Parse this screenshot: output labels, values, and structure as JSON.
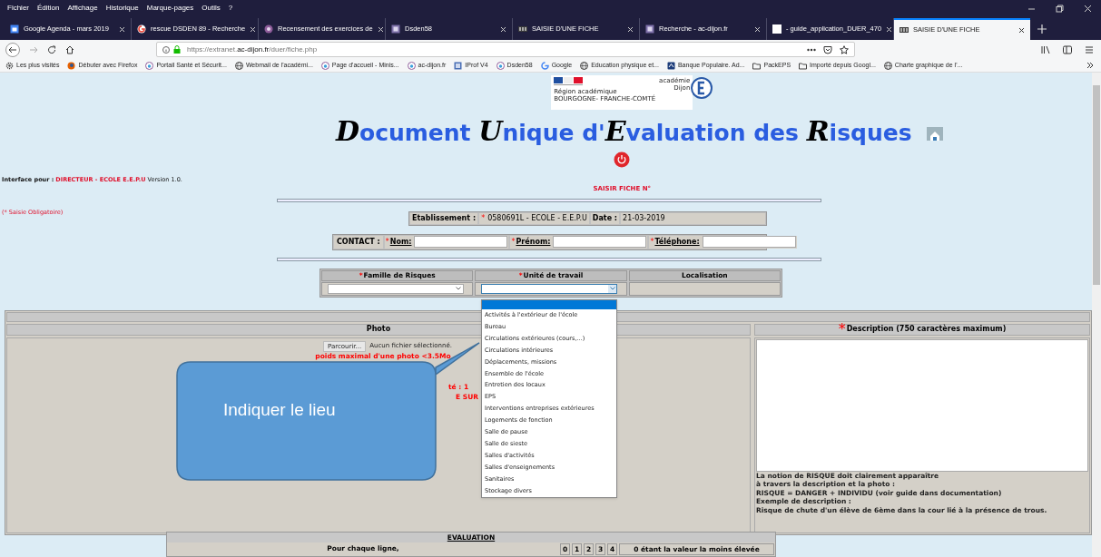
{
  "menu": [
    "Fichier",
    "Édition",
    "Affichage",
    "Historique",
    "Marque-pages",
    "Outils",
    "?"
  ],
  "tabs": [
    {
      "title": "Google Agenda - mars 2019",
      "kind": "calendar",
      "selected": false
    },
    {
      "title": "rescue DSDEN 89 - Recherche",
      "kind": "google",
      "selected": false
    },
    {
      "title": "Recensement des exercices de",
      "kind": "site",
      "selected": false
    },
    {
      "title": "Dsden58",
      "kind": "doc",
      "selected": false
    },
    {
      "title": "SAISIE D'UNE FICHE",
      "kind": "form",
      "selected": false
    },
    {
      "title": "Recherche - ac-dijon.fr",
      "kind": "doc",
      "selected": false
    },
    {
      "title": "- guide_application_DUER_470",
      "kind": "blank",
      "selected": false
    },
    {
      "title": "SAISIE D'UNE FICHE",
      "kind": "form",
      "selected": true
    }
  ],
  "address_bar": {
    "url": "https://extranet.**ac-dijon.fr**/duer/fiche.php"
  },
  "bookmarks": [
    {
      "label": "Les plus visités",
      "kind": "gear"
    },
    {
      "label": "Débuter avec Firefox",
      "kind": "firefox"
    },
    {
      "label": "Portail Santé et Sécurit...",
      "kind": "site"
    },
    {
      "label": "Webmail de l'académi...",
      "kind": "globe"
    },
    {
      "label": "Page d'accueil - Minis...",
      "kind": "site"
    },
    {
      "label": "ac-dijon.fr",
      "kind": "site"
    },
    {
      "label": "IProf V4",
      "kind": "doc"
    },
    {
      "label": "Dsden58",
      "kind": "site"
    },
    {
      "label": "Google",
      "kind": "google"
    },
    {
      "label": "Education physique et...",
      "kind": "globe"
    },
    {
      "label": "Banque Populaire. Ad...",
      "kind": "bank"
    },
    {
      "label": "PackEPS",
      "kind": "folder"
    },
    {
      "label": "Importé depuis Googl...",
      "kind": "folder"
    },
    {
      "label": "Charte graphique de l'...",
      "kind": "globe"
    }
  ],
  "header": {
    "logo": {
      "line1": "académie",
      "line2": "Dijon",
      "region": "Région académique",
      "region_name": "BOURGOGNE- FRANCHE-COMTÉ"
    },
    "title": "**D**ocument **U**nique d'**E**valuation des **R**isques",
    "user_line": {
      "label": "Interface pour :",
      "user": "DIRECTEUR - ECOLE E.E.P.U",
      "version": "Version 1.0."
    },
    "required_note": "(* Saisie Obligatoire)",
    "form_title": "SAISIR FICHE N°"
  },
  "establishment": {
    "label": "Etablissement :",
    "mark": "*",
    "value": "0580691L - ECOLE - E.E.P.U",
    "date_label": "Date :",
    "date": "21-03-2019"
  },
  "contact": {
    "label": "CONTACT :",
    "fields": [
      {
        "mark": "*",
        "label": "Nom:"
      },
      {
        "mark": "*",
        "label": "Prénom:"
      },
      {
        "mark": "*",
        "label": "Téléphone:"
      }
    ]
  },
  "location_table": {
    "columns": [
      {
        "mark": "*",
        "label": "Famille de Risques"
      },
      {
        "mark": "*",
        "label": "Unité de travail"
      },
      {
        "label": "Localisation"
      }
    ]
  },
  "unit_dropdown": {
    "blank_option_highlighted": true,
    "options": [
      "Activités à l'extérieur de l'école",
      "Bureau",
      "Circulations extérieures (cours,...)",
      "Circulations intérieures",
      "Déplacements, missions",
      "Ensemble de l'école",
      "Entretien des locaux",
      "EPS",
      "Interventions entreprises extérieures",
      "Logements de fonction",
      "Salle de pause",
      "Salle de sieste",
      "Salles d'activités",
      "Salles d'enseignements",
      "Sanitaires",
      "Stockage divers"
    ]
  },
  "photo": {
    "header": "Photo",
    "browse_button": "Parcourir...",
    "file_status": "Aucun fichier sélectionné.",
    "notes": [
      "poids maximal d'une photo <3.5Mo",
      "té : 1",
      "E SUR"
    ]
  },
  "description": {
    "mark": "*",
    "header": "Description (750 caractères maximum)",
    "help": "La notion de RISQUE doit clairement apparaître\nà travers la description et la photo :\nRISQUE = DANGER + INDIVIDU (voir guide dans documentation)\nExemple de description :\nRisque de chute d'un élève de 6ème dans la cour lié à la présence de trous."
  },
  "callout": {
    "text": "Indiquer le lieu"
  },
  "evaluation": {
    "title": "EVALUATION",
    "instruction": "Pour chaque ligne,",
    "scale": [
      "0",
      "1",
      "2",
      "3",
      "4"
    ],
    "note": "0 étant la valeur la moins élevée"
  }
}
